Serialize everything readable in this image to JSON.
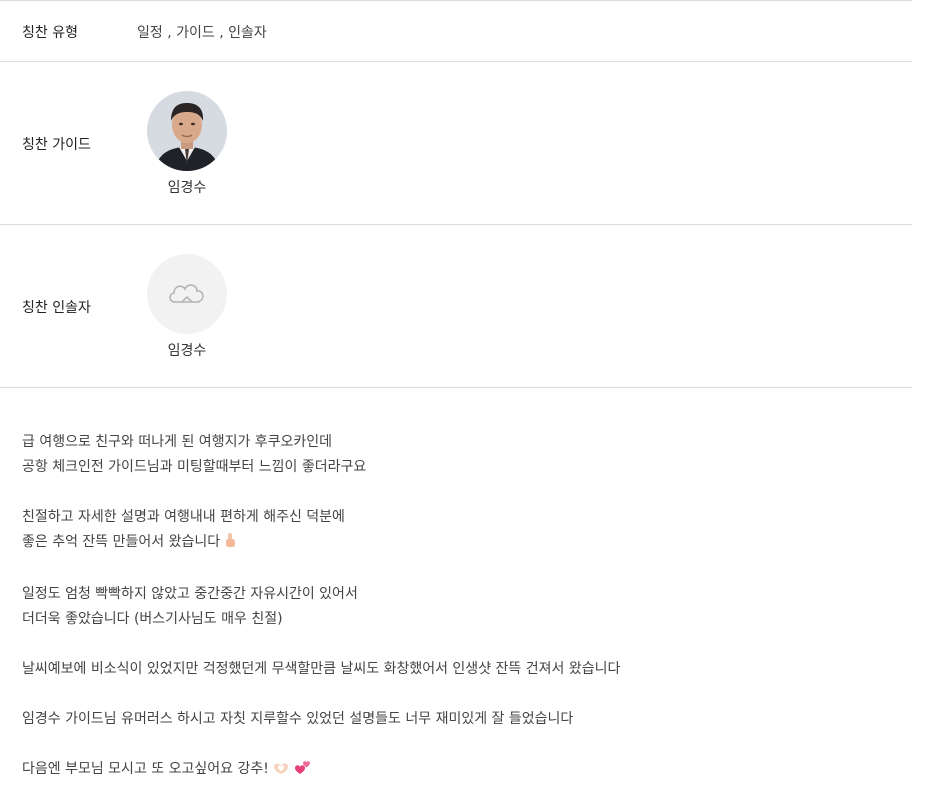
{
  "praise_type": {
    "label": "칭찬 유형",
    "value": "일정 , 가이드 , 인솔자"
  },
  "praise_guide": {
    "label": "칭찬 가이드",
    "name": "임경수",
    "avatar": "guide-photo"
  },
  "praise_escort": {
    "label": "칭찬 인솔자",
    "name": "임경수",
    "avatar": "cloud-placeholder-icon"
  },
  "review": {
    "paragraphs": [
      {
        "lines": [
          "급 여행으로 친구와 떠나게 된 여행지가 후쿠오카인데",
          "공항 체크인전 가이드님과 미팅할때부터 느낌이 좋더라구요"
        ]
      },
      {
        "lines": [
          "친절하고 자세한 설명과 여행내내 편하게 해주신 덕분에",
          "좋은 추억 잔뜩 만들어서 왔습니다"
        ]
      },
      {
        "lines": [
          "일정도 엄청 빡빡하지 않았고 중간중간 자유시간이 있어서",
          "더더욱 좋았습니다 (버스기사님도 매우 친절)"
        ]
      },
      {
        "lines": [
          "날씨예보에 비소식이 있었지만 걱정했던게 무색할만큼 날씨도 화창했어서 인생샷 잔뜩 건져서 왔습니다"
        ]
      },
      {
        "lines": [
          "임경수 가이드님 유머러스 하시고 자칫 지루할수 있었던 설명들도 너무 재미있게 잘 들었습니다"
        ]
      },
      {
        "lines": [
          "다음엔 부모님 모시고 또 오고싶어요 강추!"
        ]
      }
    ],
    "emojis": {
      "thumbs": "thumbs-up-icon",
      "heart_hands": "heart-hands-icon",
      "hearts": "two-hearts-icon"
    }
  },
  "colors": {
    "divider": "#dcdcdc",
    "text": "#444444",
    "label": "#222222",
    "placeholder_bg": "#f2f2f2",
    "heart": "#e8407a"
  }
}
